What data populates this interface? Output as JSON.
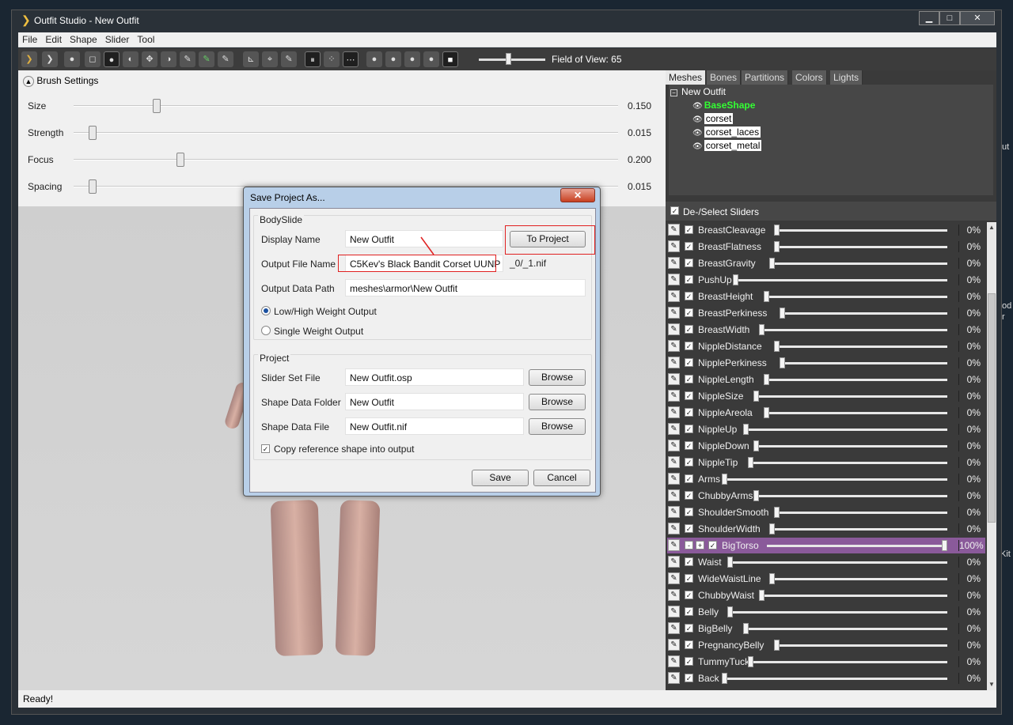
{
  "window": {
    "title": "Outfit Studio - New Outfit",
    "min": "▁",
    "max": "□",
    "close": "✕"
  },
  "menu": [
    "File",
    "Edit",
    "Shape",
    "Slider",
    "Tool"
  ],
  "toolbar": {
    "field_of_view_label": "Field of View: 65",
    "fov_value": 65
  },
  "brush_settings": {
    "title": "Brush Settings",
    "sliders": [
      {
        "label": "Size",
        "value": "0.150",
        "fraction": 0.15
      },
      {
        "label": "Strength",
        "value": "0.015",
        "fraction": 0.015
      },
      {
        "label": "Focus",
        "value": "0.200",
        "fraction": 0.2
      },
      {
        "label": "Spacing",
        "value": "0.015",
        "fraction": 0.015
      }
    ]
  },
  "status": "Ready!",
  "tabs": [
    "Meshes",
    "Bones",
    "Partitions",
    "Colors",
    "Lights"
  ],
  "tree": {
    "root": "New Outfit",
    "items": [
      {
        "label": "BaseShape",
        "color": "#33ff33"
      },
      {
        "label": "corset"
      },
      {
        "label": "corset_laces"
      },
      {
        "label": "corset_metal"
      }
    ]
  },
  "slider_header": "De-/Select Sliders",
  "sliders": [
    {
      "name": "BreastCleavage",
      "value": "0%"
    },
    {
      "name": "BreastFlatness",
      "value": "0%"
    },
    {
      "name": "BreastGravity",
      "value": "0%"
    },
    {
      "name": "PushUp",
      "value": "0%"
    },
    {
      "name": "BreastHeight",
      "value": "0%"
    },
    {
      "name": "BreastPerkiness",
      "value": "0%"
    },
    {
      "name": "BreastWidth",
      "value": "0%"
    },
    {
      "name": "NippleDistance",
      "value": "0%"
    },
    {
      "name": "NipplePerkiness",
      "value": "0%"
    },
    {
      "name": "NippleLength",
      "value": "0%"
    },
    {
      "name": "NippleSize",
      "value": "0%"
    },
    {
      "name": "NippleAreola",
      "value": "0%"
    },
    {
      "name": "NippleUp",
      "value": "0%"
    },
    {
      "name": "NippleDown",
      "value": "0%"
    },
    {
      "name": "NippleTip",
      "value": "0%"
    },
    {
      "name": "Arms",
      "value": "0%"
    },
    {
      "name": "ChubbyArms",
      "value": "0%"
    },
    {
      "name": "ShoulderSmooth",
      "value": "0%"
    },
    {
      "name": "ShoulderWidth",
      "value": "0%"
    },
    {
      "name": "BigTorso",
      "value": "100%",
      "highlight": true,
      "minus": "-",
      "plus": "+"
    },
    {
      "name": "Waist",
      "value": "0%"
    },
    {
      "name": "WideWaistLine",
      "value": "0%"
    },
    {
      "name": "ChubbyWaist",
      "value": "0%"
    },
    {
      "name": "Belly",
      "value": "0%"
    },
    {
      "name": "BigBelly",
      "value": "0%"
    },
    {
      "name": "PregnancyBelly",
      "value": "0%"
    },
    {
      "name": "TummyTuck",
      "value": "0%"
    },
    {
      "name": "Back",
      "value": "0%"
    }
  ],
  "dialog": {
    "title": "Save Project As...",
    "close": "✕",
    "bodyslide_group": "BodySlide",
    "display_name_label": "Display Name",
    "display_name_value": "New Outfit",
    "to_project": "To Project",
    "output_file_label": "Output File Name",
    "output_file_value": "C5Kev's Black Bandit Corset UUNP",
    "output_suffix": "_0/_1.nif",
    "output_path_label": "Output Data Path",
    "output_path_value": "meshes\\armor\\New Outfit",
    "low_high": "Low/High Weight Output",
    "single": "Single Weight Output",
    "project_group": "Project",
    "slider_set_label": "Slider Set File",
    "slider_set_value": "New Outfit.osp",
    "shape_folder_label": "Shape Data Folder",
    "shape_folder_value": "New Outfit",
    "shape_file_label": "Shape Data File",
    "shape_file_value": "New Outfit.nif",
    "browse": "Browse",
    "copy_ref": "Copy reference shape into output",
    "save": "Save",
    "cancel": "Cancel",
    "checkmark": "✓"
  },
  "edge_text": [
    "ut",
    "od",
    "r",
    "Kit"
  ]
}
